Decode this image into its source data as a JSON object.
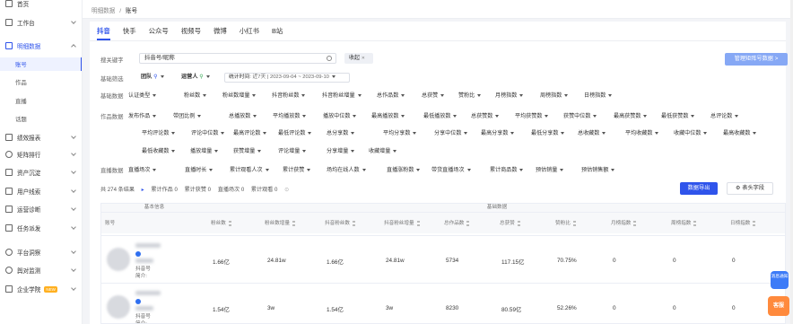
{
  "sidebar": {
    "items": [
      {
        "label": "首页",
        "icon": "home-icon"
      },
      {
        "label": "工作台",
        "icon": "workbench-icon"
      },
      {
        "label": "明细数据",
        "icon": "detail-data-icon"
      },
      {
        "label": "绩效报表",
        "icon": "report-icon"
      },
      {
        "label": "矩阵排行",
        "icon": "ranking-icon"
      },
      {
        "label": "资产沉淀",
        "icon": "assets-icon"
      },
      {
        "label": "用户线索",
        "icon": "leads-icon"
      },
      {
        "label": "运营诊断",
        "icon": "diagnosis-icon"
      },
      {
        "label": "任务派发",
        "icon": "task-icon"
      },
      {
        "label": "平台洞察",
        "icon": "insight-icon"
      },
      {
        "label": "舆对监测",
        "icon": "monitor-icon"
      },
      {
        "label": "企业学院",
        "icon": "academy-icon",
        "badge": "NEW"
      }
    ],
    "sub_items": [
      "账号",
      "作品",
      "直播",
      "话题"
    ]
  },
  "breadcrumb": {
    "parent": "明细数据",
    "sep": "/",
    "current": "账号"
  },
  "tabs": [
    "抖音",
    "快手",
    "公众号",
    "视频号",
    "微博",
    "小红书",
    "B站"
  ],
  "search": {
    "label": "搜关键字",
    "placeholder": "抖音号/昵称",
    "collapse": "收起",
    "manage": "管理矩阵号数据 >"
  },
  "basic_filter": {
    "label": "基础筛选",
    "team": "团队",
    "operator": "运营人",
    "stat_time_label": "统计时间:",
    "stat_time_value": "近7天 | 2023-09-04 ~ 2023-09-10"
  },
  "base_metrics": {
    "label": "基础数据",
    "items": [
      "认证类型",
      "粉丝数",
      "粉丝数增量",
      "抖音粉丝数",
      "抖音粉丝增量",
      "总作品数",
      "总获赞",
      "赞粉比",
      "月榜指数",
      "周榜指数",
      "日榜指数"
    ]
  },
  "work_metrics": {
    "label": "作品数据",
    "rows": [
      [
        "发布作品",
        "带团比例",
        "总播放数",
        "平均播放数",
        "播放中位数",
        "最高播放数",
        "最低播放数",
        "总获赞数",
        "平均获赞数",
        "获赞中位数",
        "最高获赞数",
        "最低获赞数",
        "总评论数"
      ],
      [
        "平均评论数",
        "评论中位数",
        "最高评论数",
        "最低评论数",
        "总分享数",
        "平均分享数",
        "分享中位数",
        "最高分享数",
        "最低分享数",
        "总收藏数",
        "平均收藏数",
        "收藏中位数",
        "最高收藏数"
      ],
      [
        "最低收藏数",
        "播放增量",
        "获赞增量",
        "评论增量",
        "分享增量",
        "收藏增量"
      ]
    ]
  },
  "live_metrics": {
    "label": "直播数据",
    "items": [
      "直播场次",
      "直播时长",
      "累计观看人次",
      "累计获赞",
      "场均在线人数",
      "直播涨粉数",
      "带货直播场次",
      "累计商品数",
      "预估销量",
      "预估销售额"
    ]
  },
  "summary": {
    "total": "共 274 条结果",
    "works": "累计作品 0",
    "likes": "累计获赞 0",
    "lives": "直播场次 0",
    "views": "累计观看 0",
    "export": "数据导出",
    "columns": "表头字段"
  },
  "table": {
    "group_basic": "基本信息",
    "group_base": "基础数据",
    "headers": [
      "账号",
      "粉丝数",
      "粉丝数增量",
      "抖音粉丝数",
      "抖音粉丝增量",
      "总作品数",
      "总获赞",
      "赞粉比",
      "月榜指数",
      "周榜指数",
      "日榜指数"
    ],
    "rows": [
      {
        "id_label": "抖音号",
        "intro_label": "简介:",
        "values": [
          "1.66亿",
          "24.81w",
          "1.66亿",
          "24.81w",
          "5734",
          "117.15亿",
          "70.75%",
          "0",
          "0",
          "0"
        ]
      },
      {
        "id_label": "抖音号",
        "intro_label": "简介:",
        "values": [
          "1.54亿",
          "3w",
          "1.54亿",
          "3w",
          "8230",
          "80.59亿",
          "52.26%",
          "0",
          "0",
          "0"
        ]
      }
    ]
  },
  "float": {
    "a": "消息通知",
    "b": "客服"
  },
  "colors": {
    "accent": "#2f54eb",
    "manage_btn": "#86a8f5",
    "float_orange": "#ff8a3d"
  }
}
